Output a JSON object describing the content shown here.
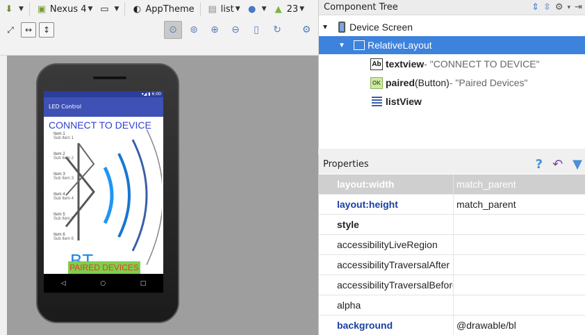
{
  "toolbar": {
    "device_label": "Nexus 4",
    "theme_label": "AppTheme",
    "layout_label": "list",
    "api_label": "23"
  },
  "device_preview": {
    "status_time": "6:00",
    "app_title": "LED Control",
    "connect_text": "CONNECT TO DEVICE",
    "list_items": [
      {
        "title": "Item 1",
        "sub": "Sub Item 1"
      },
      {
        "title": "Item 2",
        "sub": "Sub Item 2"
      },
      {
        "title": "Item 3",
        "sub": "Sub Item 3"
      },
      {
        "title": "Item 4",
        "sub": "Sub Item 4"
      },
      {
        "title": "Item 5",
        "sub": "Sub Item 5"
      },
      {
        "title": "Item 6",
        "sub": "Sub Item 6"
      }
    ],
    "bt_text": "BT",
    "paired_button": "PAIRED DEVICES",
    "nav_back": "◁",
    "nav_home": "○",
    "nav_recent": "□"
  },
  "component_tree": {
    "title": "Component Tree",
    "device_screen": "Device Screen",
    "relative_layout": "RelativeLayout",
    "textview_name": "textview",
    "textview_desc": " - \"CONNECT TO DEVICE\"",
    "paired_name": "paired",
    "paired_type": " (Button)",
    "paired_desc": " - \"Paired Devices\"",
    "listview_name": "listView",
    "ab_icon": "Ab",
    "ok_icon": "OK"
  },
  "properties": {
    "title": "Properties",
    "rows": [
      {
        "name": "layout:width",
        "value": "match_parent"
      },
      {
        "name": "layout:height",
        "value": "match_parent"
      },
      {
        "name": "style",
        "value": ""
      },
      {
        "name": "accessibilityLiveRegion",
        "value": ""
      },
      {
        "name": "accessibilityTraversalAfter",
        "value": ""
      },
      {
        "name": "accessibilityTraversalBefore",
        "value": ""
      },
      {
        "name": "alpha",
        "value": ""
      },
      {
        "name": "background",
        "value": "@drawable/bl"
      }
    ]
  },
  "colors": {
    "selection": "#3d82dc",
    "accent_blue": "#1a3fa3",
    "app_bar": "#3f51b5",
    "paired_button_bg": "#7ed04b",
    "paired_button_text": "#e53935"
  }
}
